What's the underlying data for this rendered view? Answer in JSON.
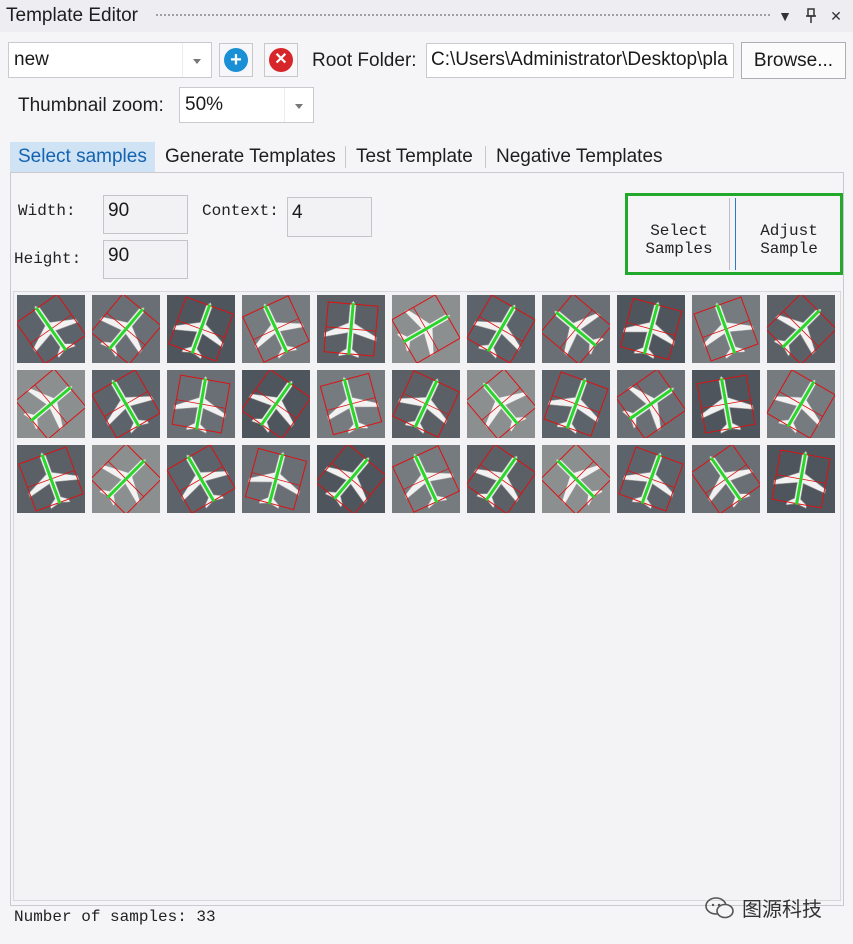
{
  "window": {
    "title": "Template Editor"
  },
  "toolbar": {
    "template_name": "new",
    "root_folder_label": "Root Folder:",
    "root_folder_value": "C:\\Users\\Administrator\\Desktop\\pla",
    "browse_label": "Browse...",
    "zoom_label": "Thumbnail zoom:",
    "zoom_value": "50%"
  },
  "tabs": [
    {
      "label": "Select samples",
      "active": true
    },
    {
      "label": "Generate Templates",
      "active": false
    },
    {
      "label": "Test Template",
      "active": false
    },
    {
      "label": "Negative Templates",
      "active": false
    }
  ],
  "params": {
    "width_label": "Width:",
    "width_value": "90",
    "height_label": "Height:",
    "height_value": "90",
    "context_label": "Context:",
    "context_value": "4"
  },
  "actions": {
    "select_samples_line1": "Select",
    "select_samples_line2": "Samples",
    "adjust_sample_line1": "Adjust",
    "adjust_sample_line2": "Sample"
  },
  "samples": {
    "rows": 3,
    "cols": 11,
    "rotations": [
      -35,
      40,
      20,
      -25,
      5,
      60,
      30,
      -50,
      15,
      -20,
      45,
      50,
      -30,
      10,
      35,
      -15,
      25,
      -40,
      20,
      55,
      -10,
      30,
      -20,
      45,
      -30,
      15,
      40,
      -25,
      35,
      -45,
      20,
      -35,
      10
    ]
  },
  "status": {
    "text": "Number of samples: 33"
  },
  "watermark": {
    "text": "图源科技"
  },
  "colors": {
    "accent": "#1b8fd6",
    "delete": "#d6262a",
    "highlight": "#22a82a",
    "sample_box": "#dd1111",
    "sample_axis": "#2bd62b"
  }
}
